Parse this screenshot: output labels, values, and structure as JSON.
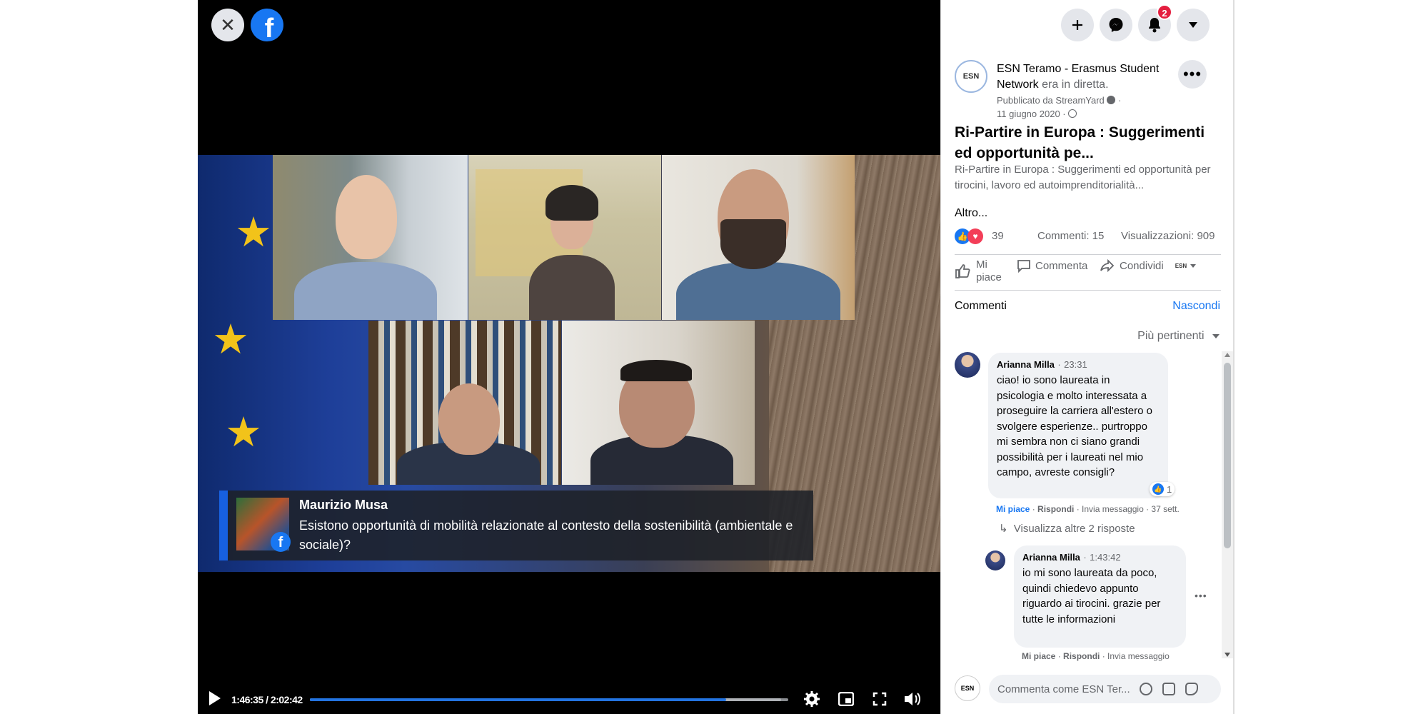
{
  "viewer": {
    "close_label": "✕",
    "logo_letter": "f",
    "caption": {
      "name": "Maurizio Musa",
      "text": "Esistono opportunità di mobilità relazionate al contesto della sostenibilità (ambientale e sociale)?"
    },
    "controls": {
      "time": "1:46:35 / 2:02:42",
      "progress_fraction": 0.87,
      "buffer_fraction": 0.985
    }
  },
  "topbar": {
    "create_icon": "plus-icon",
    "messenger_icon": "messenger-icon",
    "notifications_icon": "bell-icon",
    "notifications_badge": "2",
    "account_icon": "caret-down-icon"
  },
  "post": {
    "page_avatar_text": "ESN",
    "page_name": "ESN Teramo - Erasmus Student Network",
    "status": " era in diretta.",
    "published_by": "Pubblicato da StreamYard",
    "date": "11 giugno 2020",
    "title": "Ri-Partire in Europa : Suggerimenti ed opportunità pe...",
    "description": "Ri-Partire in Europa : Suggerimenti ed opportunità per tirocini, lavoro ed autoimprenditorialità...",
    "more_link": "Altro...",
    "reactions_count": "39",
    "comments_count": "Commenti: 15",
    "views_count": "Visualizzazioni: 909",
    "like_label": "Mi piace",
    "comment_label": "Commenta",
    "share_label": "Condividi",
    "share_avatar_text": "ESN"
  },
  "comments": {
    "header": "Commenti",
    "hide_label": "Nascondi",
    "sort_label": "Più pertinenti",
    "items": [
      {
        "author": "Arianna Milla",
        "time": "23:31",
        "text": "ciao! io sono laureata in psicologia e molto interessata a proseguire la carriera all'estero o svolgere esperienze.. purtroppo mi sembra non ci siano grandi possibilità per i laureati nel mio campo, avreste consigli?",
        "reactions": "1",
        "like": "Mi piace",
        "reply": "Rispondi",
        "message": "Invia messaggio",
        "age": "37 sett.",
        "view_replies": "Visualizza altre 2 risposte"
      },
      {
        "author": "Arianna Milla",
        "time": "1:43:42",
        "text": "io mi sono laureata da poco, quindi chiedevo appunto riguardo ai tirocini. grazie per tutte le informazioni",
        "like": "Mi piace",
        "reply": "Rispondi",
        "message": "Invia messaggio"
      }
    ],
    "compose_placeholder": "Commenta come ESN Ter...",
    "compose_avatar_text": "ESN"
  },
  "colors": {
    "accent": "#1877f2",
    "badge": "#e41e3f",
    "caption_bar": "#1760e0"
  }
}
